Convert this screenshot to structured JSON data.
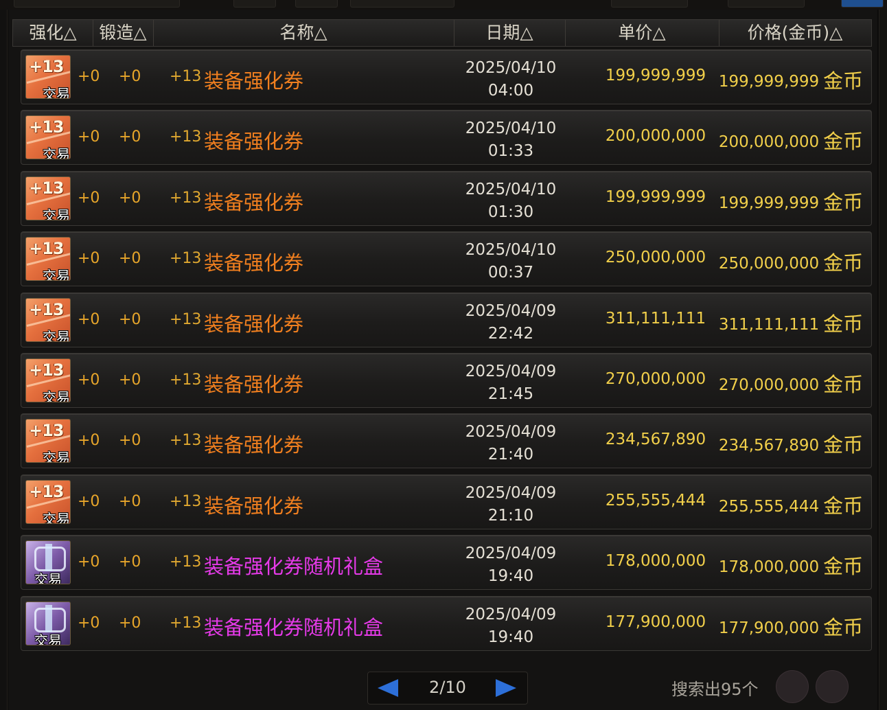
{
  "header": {
    "columns": [
      "强化△",
      "锻造△",
      "名称△",
      "日期△",
      "单价△",
      "价格(金币)△"
    ]
  },
  "rows": [
    {
      "icon": "ticket-icon",
      "trade": "交易",
      "enhance": "+0",
      "forge": "+0",
      "level": "+13",
      "name": "装备强化券",
      "date": "2025/04/10",
      "time": "04:00",
      "unit_price": "199,999,999",
      "price": "199,999,999",
      "currency": "金币"
    },
    {
      "icon": "ticket-icon",
      "trade": "交易",
      "enhance": "+0",
      "forge": "+0",
      "level": "+13",
      "name": "装备强化券",
      "date": "2025/04/10",
      "time": "01:33",
      "unit_price": "200,000,000",
      "price": "200,000,000",
      "currency": "金币"
    },
    {
      "icon": "ticket-icon",
      "trade": "交易",
      "enhance": "+0",
      "forge": "+0",
      "level": "+13",
      "name": "装备强化券",
      "date": "2025/04/10",
      "time": "01:30",
      "unit_price": "199,999,999",
      "price": "199,999,999",
      "currency": "金币"
    },
    {
      "icon": "ticket-icon",
      "trade": "交易",
      "enhance": "+0",
      "forge": "+0",
      "level": "+13",
      "name": "装备强化券",
      "date": "2025/04/10",
      "time": "00:37",
      "unit_price": "250,000,000",
      "price": "250,000,000",
      "currency": "金币"
    },
    {
      "icon": "ticket-icon",
      "trade": "交易",
      "enhance": "+0",
      "forge": "+0",
      "level": "+13",
      "name": "装备强化券",
      "date": "2025/04/09",
      "time": "22:42",
      "unit_price": "311,111,111",
      "price": "311,111,111",
      "currency": "金币"
    },
    {
      "icon": "ticket-icon",
      "trade": "交易",
      "enhance": "+0",
      "forge": "+0",
      "level": "+13",
      "name": "装备强化券",
      "date": "2025/04/09",
      "time": "21:45",
      "unit_price": "270,000,000",
      "price": "270,000,000",
      "currency": "金币"
    },
    {
      "icon": "ticket-icon",
      "trade": "交易",
      "enhance": "+0",
      "forge": "+0",
      "level": "+13",
      "name": "装备强化券",
      "date": "2025/04/09",
      "time": "21:40",
      "unit_price": "234,567,890",
      "price": "234,567,890",
      "currency": "金币"
    },
    {
      "icon": "ticket-icon",
      "trade": "交易",
      "enhance": "+0",
      "forge": "+0",
      "level": "+13",
      "name": "装备强化券",
      "date": "2025/04/09",
      "time": "21:10",
      "unit_price": "255,555,444",
      "price": "255,555,444",
      "currency": "金币"
    },
    {
      "icon": "gift-box-icon",
      "trade": "交易",
      "enhance": "+0",
      "forge": "+0",
      "level": "+13",
      "name": "装备强化券随机礼盒",
      "date": "2025/04/09",
      "time": "19:40",
      "unit_price": "178,000,000",
      "price": "178,000,000",
      "currency": "金币"
    },
    {
      "icon": "gift-box-icon",
      "trade": "交易",
      "enhance": "+0",
      "forge": "+0",
      "level": "+13",
      "name": "装备强化券随机礼盒",
      "date": "2025/04/09",
      "time": "19:40",
      "unit_price": "177,900,000",
      "price": "177,900,000",
      "currency": "金币"
    }
  ],
  "pager": {
    "page": "2/10"
  },
  "search_result": "搜索出95个",
  "colors": {
    "name_orange": "#f07f1f",
    "name_purple": "#e53ae8",
    "price_gold": "#f1cf4a",
    "arrow_blue": "#2d6fd8"
  }
}
